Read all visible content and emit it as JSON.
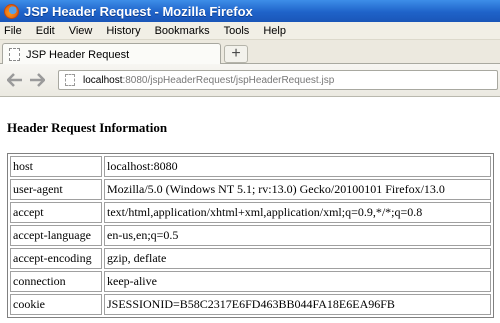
{
  "window": {
    "title": "JSP Header Request - Mozilla Firefox"
  },
  "menu": [
    "File",
    "Edit",
    "View",
    "History",
    "Bookmarks",
    "Tools",
    "Help"
  ],
  "tab": {
    "label": "JSP Header Request",
    "new_tab_symbol": "+"
  },
  "nav": {
    "back_icon": "back-arrow-icon",
    "forward_icon": "forward-arrow-icon",
    "url_host": "localhost",
    "url_path": ":8080/jspHeaderRequest/jspHeaderRequest.jsp"
  },
  "page": {
    "heading": "Header Request Information",
    "rows": [
      {
        "name": "host",
        "value": "localhost:8080"
      },
      {
        "name": "user-agent",
        "value": "Mozilla/5.0 (Windows NT 5.1; rv:13.0) Gecko/20100101 Firefox/13.0"
      },
      {
        "name": "accept",
        "value": "text/html,application/xhtml+xml,application/xml;q=0.9,*/*;q=0.8"
      },
      {
        "name": "accept-language",
        "value": "en-us,en;q=0.5"
      },
      {
        "name": "accept-encoding",
        "value": "gzip, deflate"
      },
      {
        "name": "connection",
        "value": "keep-alive"
      },
      {
        "name": "cookie",
        "value": "JSESSIONID=B58C2317E6FD463BB044FA18E6EA96FB"
      }
    ]
  },
  "colors": {
    "titlebar": "#1f63c9",
    "menubar": "#f1efe6"
  }
}
